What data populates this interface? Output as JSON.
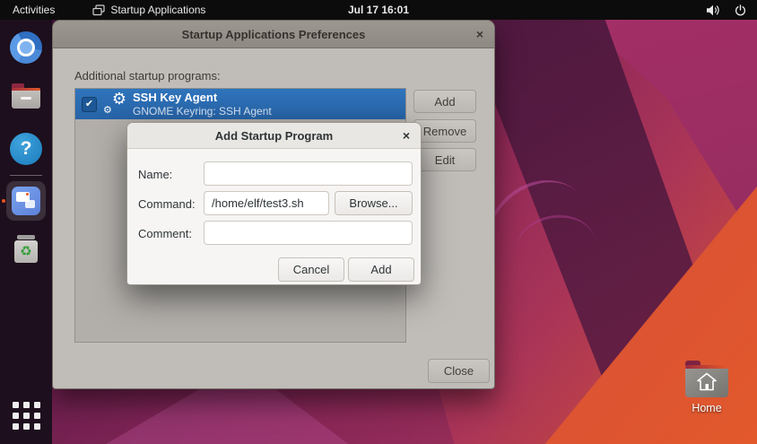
{
  "topbar": {
    "activities_label": "Activities",
    "app_menu_label": "Startup Applications",
    "clock": "Jul 17 16:01"
  },
  "main_window": {
    "title": "Startup Applications Preferences",
    "close_glyph": "×",
    "section_label": "Additional startup programs:",
    "startup_items": [
      {
        "checked": true,
        "check_glyph": "✔",
        "gear_glyph": "⚙",
        "title": "SSH Key Agent",
        "subtitle": "GNOME Keyring: SSH Agent"
      }
    ],
    "buttons": {
      "add": "Add",
      "remove": "Remove",
      "edit": "Edit",
      "close": "Close"
    }
  },
  "dialog": {
    "title": "Add Startup Program",
    "close_glyph": "×",
    "fields": {
      "name": {
        "label": "Name:",
        "value": ""
      },
      "command": {
        "label": "Command:",
        "value": "/home/elf/test3.sh"
      },
      "comment": {
        "label": "Comment:",
        "value": ""
      }
    },
    "browse_label": "Browse...",
    "cancel_label": "Cancel",
    "add_label": "Add"
  },
  "dock": {
    "help_glyph": "?",
    "trash_glyph": "♻"
  },
  "desktop": {
    "home_icon_label": "Home"
  },
  "colors": {
    "selection_blue": "#2b6cb3",
    "accent_orange": "#e95420",
    "topbar_bg": "#0c0c0c",
    "dialog_bg": "#f6f5f4",
    "titlebar_gray": "#95918a"
  }
}
